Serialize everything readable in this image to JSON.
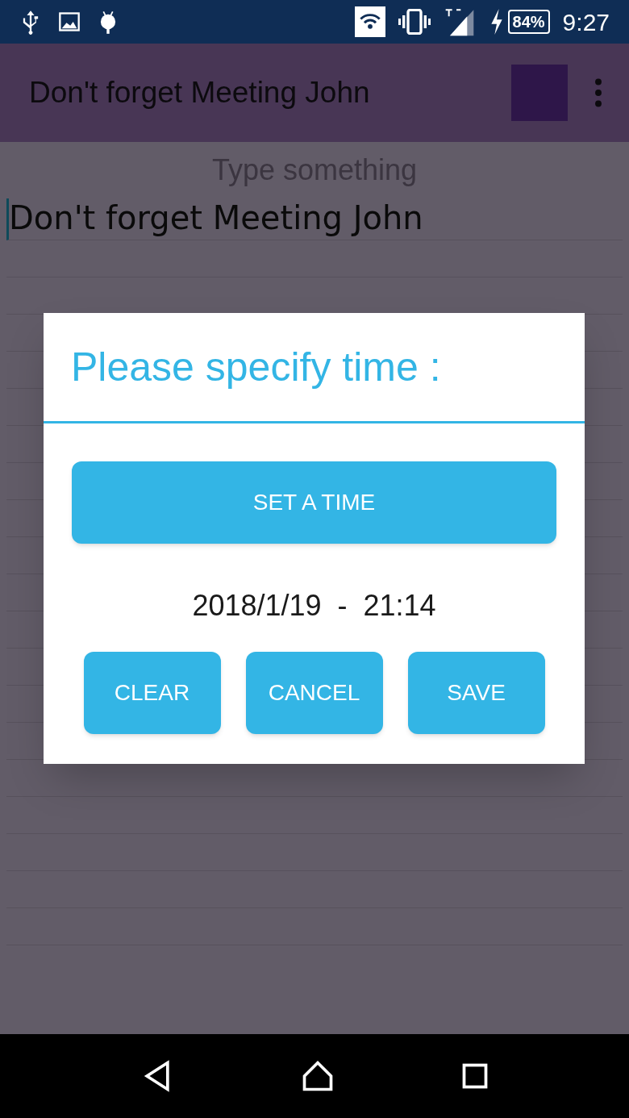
{
  "status_bar": {
    "battery": "84%",
    "time": "9:27"
  },
  "app_bar": {
    "title": "Don't forget Meeting John"
  },
  "note": {
    "placeholder": "Type something",
    "text": "Don't forget Meeting John"
  },
  "dialog": {
    "title": "Please specify time :",
    "set_button": "SET A TIME",
    "datetime": "2018/1/19  -  21:14",
    "buttons": [
      "CLEAR",
      "CANCEL",
      "SAVE"
    ]
  }
}
